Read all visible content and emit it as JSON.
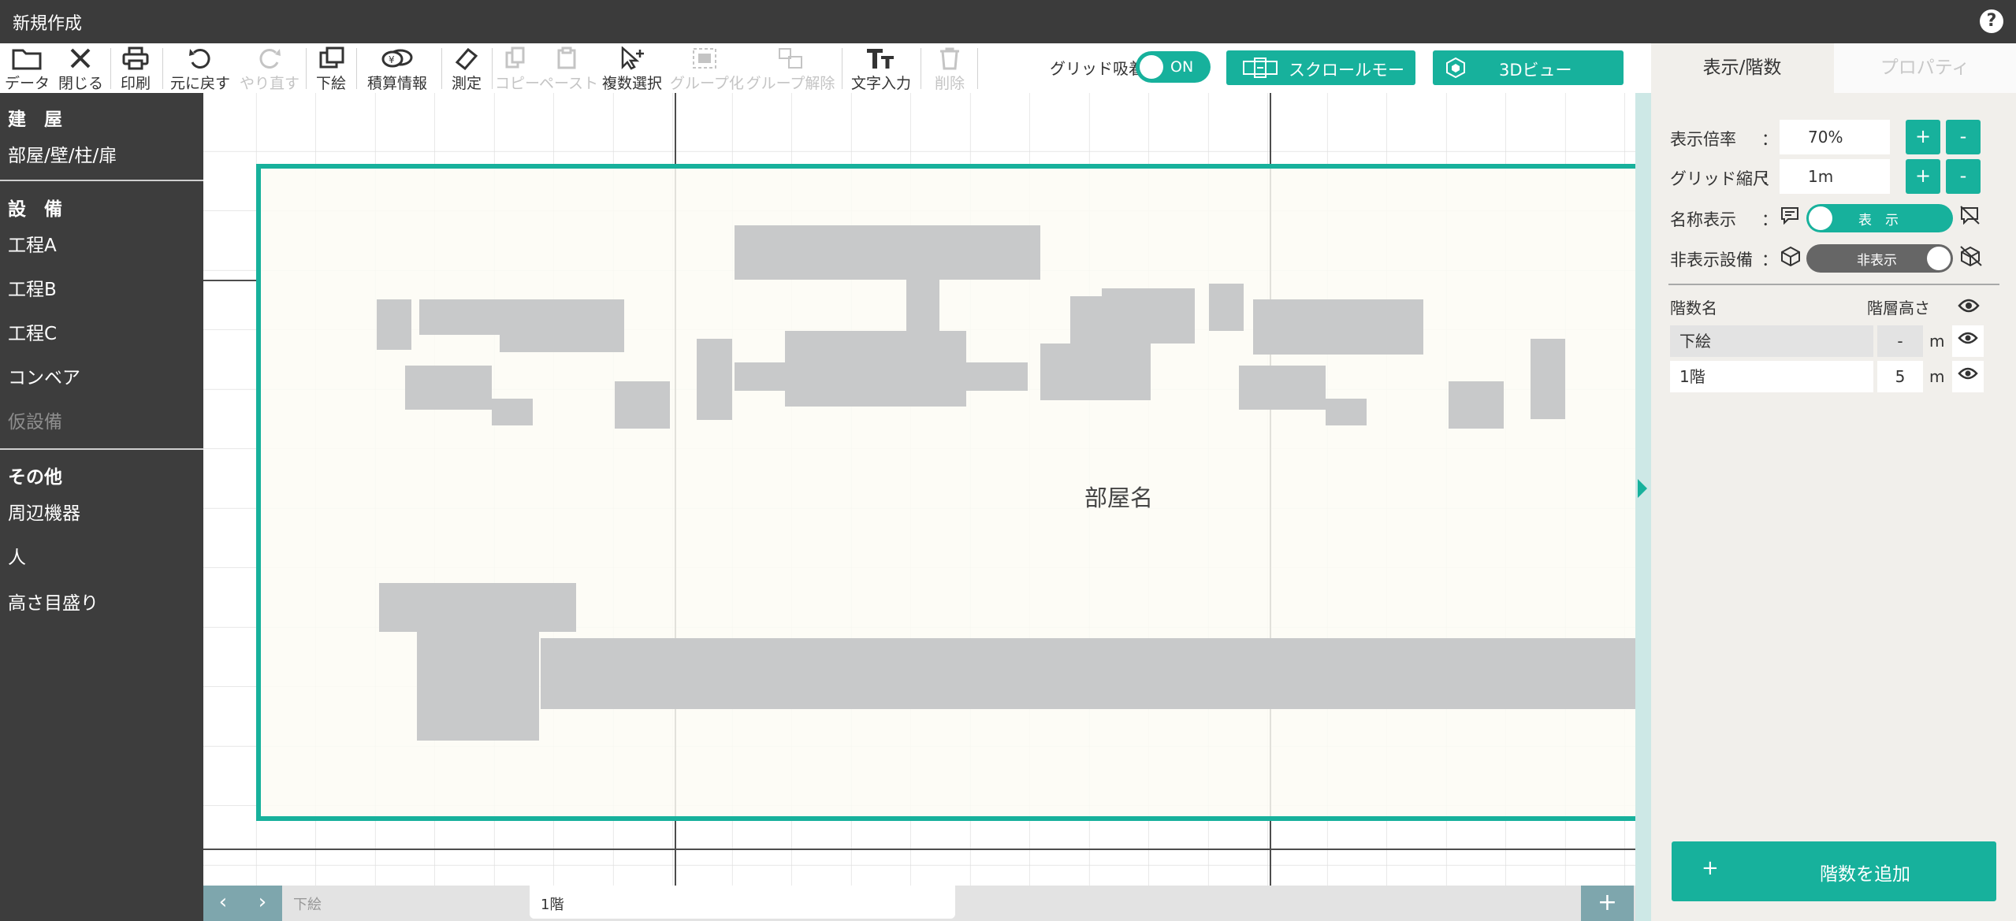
{
  "window": {
    "title": "新規作成",
    "help_icon": "?"
  },
  "toolbar": {
    "data": "データ",
    "close": "閉じる",
    "print": "印刷",
    "undo": "元に戻す",
    "redo": "やり直す",
    "underlay": "下絵",
    "estimate": "積算情報",
    "measure": "測定",
    "copy": "コピー",
    "paste": "ペースト",
    "multi_select": "複数選択",
    "group": "グループ化",
    "ungroup": "グループ解除",
    "text_input": "文字入力",
    "delete": "削除",
    "grid_snap_label": "グリッド吸着",
    "grid_snap_state": "ON",
    "scroll_mode": "スクロールモード",
    "view_3d": "3Dビュー"
  },
  "sidebar": {
    "sections": [
      {
        "heading": "建　屋",
        "items": [
          "部屋/壁/柱/扉"
        ]
      },
      {
        "heading": "設　備",
        "items": [
          "工程A",
          "工程B",
          "工程C",
          "コンベア",
          "仮設備"
        ]
      },
      {
        "heading": "その他",
        "items": [
          "周辺機器",
          "人",
          "高さ目盛り"
        ]
      }
    ]
  },
  "canvas": {
    "room_name": "部屋名"
  },
  "bottom_tabs": {
    "prev": "‹",
    "next": "›",
    "tabs": [
      "下絵",
      "1階"
    ],
    "active": "1階",
    "add": "+"
  },
  "right_panel": {
    "tabs": [
      "表示/階数",
      "プロパティ"
    ],
    "active_tab": "表示/階数",
    "zoom_label": "表示倍率",
    "zoom_value": "70%",
    "grid_scale_label": "グリッド縮尺",
    "grid_scale_value": "1m",
    "name_display_label": "名称表示",
    "name_display_state": "表　示",
    "hidden_equipment_label": "非表示設備",
    "hidden_equipment_state": "非表示",
    "colon": "：",
    "floor_table": {
      "col_name": "階数名",
      "col_height": "階層高さ",
      "rows": [
        {
          "name": "下絵",
          "height": "-",
          "unit": "m"
        },
        {
          "name": "1階",
          "height": "5",
          "unit": "m"
        }
      ]
    },
    "add_floor": "階数を追加",
    "plus": "+",
    "minus": "-"
  },
  "colors": {
    "accent": "#17b19c",
    "dark": "#3b3b3b",
    "canvas_room": "#fdfbf4",
    "equipment": "#c8c9ca"
  }
}
